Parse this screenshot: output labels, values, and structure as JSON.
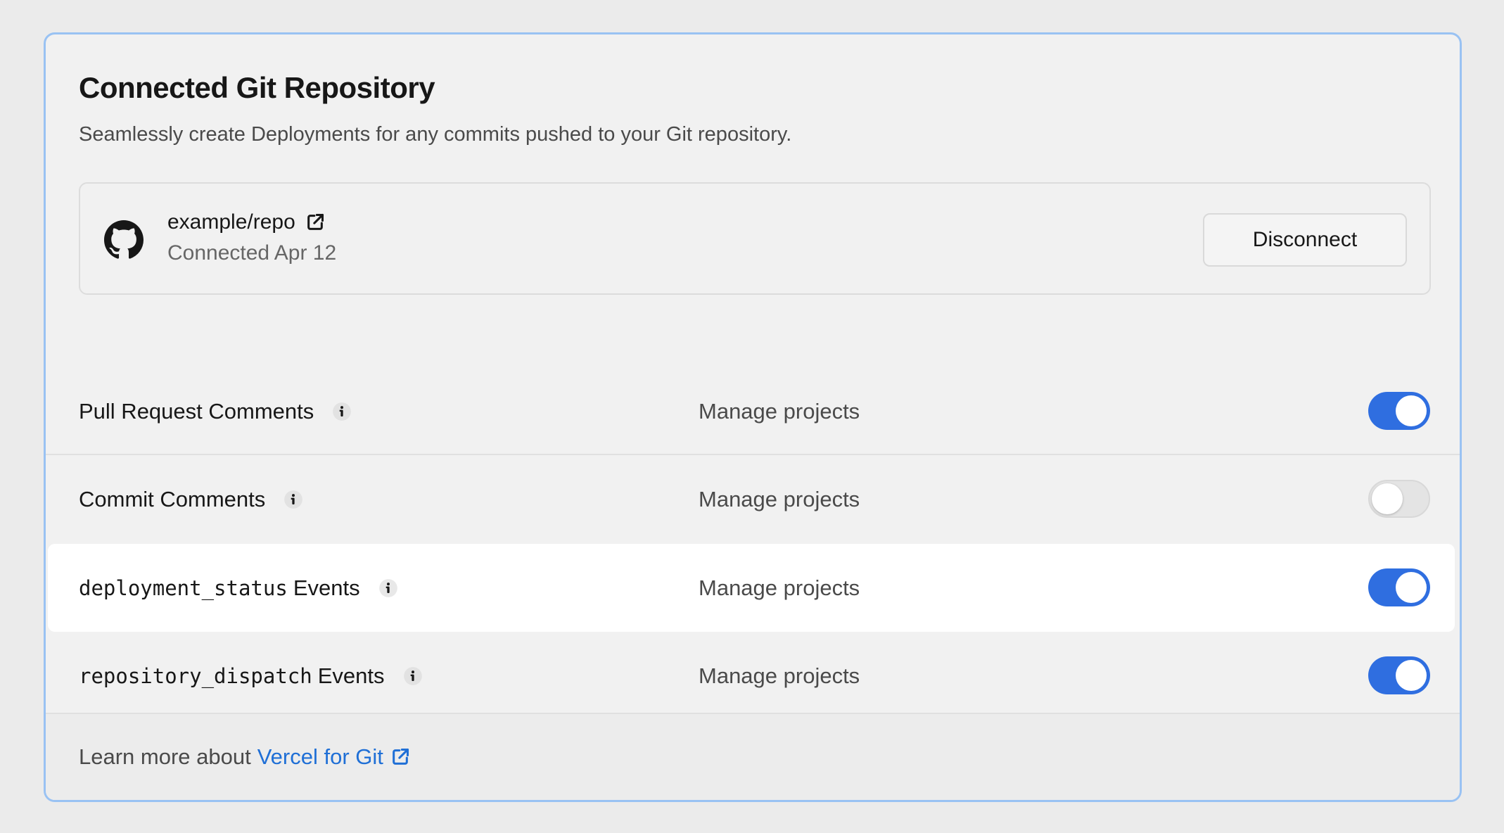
{
  "card": {
    "title": "Connected Git Repository",
    "subtitle": "Seamlessly create Deployments for any commits pushed to your Git repository."
  },
  "repo": {
    "icon": "github-icon",
    "name": "example/repo",
    "connected": "Connected Apr 12",
    "disconnect_label": "Disconnect"
  },
  "settings": [
    {
      "code": "",
      "label": "Pull Request Comments",
      "manage_label": "Manage projects",
      "enabled": true
    },
    {
      "code": "",
      "label": "Commit Comments",
      "manage_label": "Manage projects",
      "enabled": false
    },
    {
      "code": "deployment_status",
      "label": "Events",
      "manage_label": "Manage projects",
      "enabled": true
    },
    {
      "code": "repository_dispatch",
      "label": "Events",
      "manage_label": "Manage projects",
      "enabled": true
    }
  ],
  "footer": {
    "text": "Learn more about",
    "link_label": "Vercel for Git"
  },
  "colors": {
    "accent": "#2f6ee0",
    "link": "#1f6fd6",
    "card_border": "#99c2f3"
  }
}
